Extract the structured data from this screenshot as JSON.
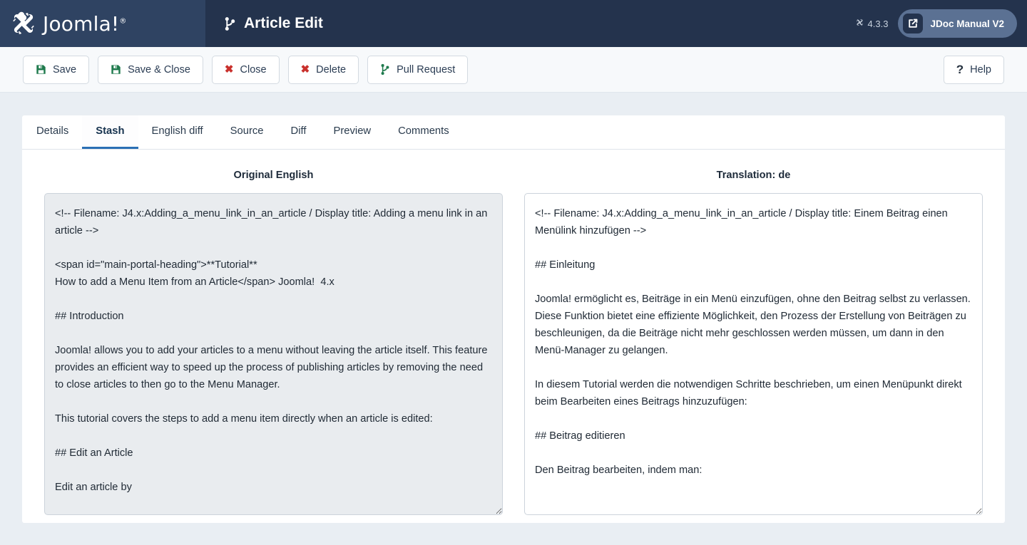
{
  "header": {
    "brand_name": "Joomla!",
    "brand_tm": "®",
    "brand_logo_icon": "joomla-logo-icon",
    "page_title": "Article Edit",
    "page_title_icon": "git-branch-icon",
    "version_label": "4.3.3",
    "version_icon": "joomla-mark-icon",
    "manual_button_label": "JDoc Manual V2",
    "manual_button_icon": "external-link-icon",
    "colors": {
      "brand_bg": "#2f4362",
      "header_bg": "#24334d",
      "manual_btn_bg": "#5b7193"
    }
  },
  "toolbar": {
    "buttons": [
      {
        "label": "Save",
        "icon": "save-floppy-icon",
        "icon_color": "#1f7a4d"
      },
      {
        "label": "Save & Close",
        "icon": "save-floppy-icon",
        "icon_color": "#1f7a4d"
      },
      {
        "label": "Close",
        "icon": "x-mark-icon",
        "icon_color": "#c9302c"
      },
      {
        "label": "Delete",
        "icon": "x-mark-icon",
        "icon_color": "#c9302c"
      },
      {
        "label": "Pull Request",
        "icon": "git-branch-icon",
        "icon_color": "#1f7a4d"
      }
    ],
    "help": {
      "label": "Help",
      "icon": "question-mark-icon"
    }
  },
  "tabs": [
    {
      "label": "Details",
      "active": false
    },
    {
      "label": "Stash",
      "active": true
    },
    {
      "label": "English diff",
      "active": false
    },
    {
      "label": "Source",
      "active": false
    },
    {
      "label": "Diff",
      "active": false
    },
    {
      "label": "Preview",
      "active": false
    },
    {
      "label": "Comments",
      "active": false
    }
  ],
  "panes": {
    "left": {
      "title": "Original English",
      "readonly": true,
      "value": "<!-- Filename: J4.x:Adding_a_menu_link_in_an_article / Display title: Adding a menu link in an article -->\n\n<span id=\"main-portal-heading\">**Tutorial**\nHow to add a Menu Item from an Article</span> Joomla!  4.x\n\n## Introduction\n\nJoomla! allows you to add your articles to a menu without leaving the article itself. This feature provides an efficient way to speed up the process of publishing articles by removing the need to close articles to then go to the Menu Manager.\n\nThis tutorial covers the steps to add a menu item directly when an article is edited:\n\n## Edit an Article\n\nEdit an article by"
    },
    "right": {
      "title": "Translation: de",
      "readonly": false,
      "value": "<!-- Filename: J4.x:Adding_a_menu_link_in_an_article / Display title: Einem Beitrag einen Menülink hinzufügen -->\n\n## Einleitung\n\nJoomla! ermöglicht es, Beiträge in ein Menü einzufügen, ohne den Beitrag selbst zu verlassen. Diese Funktion bietet eine effiziente Möglichkeit, den Prozess der Erstellung von Beiträgen zu beschleunigen, da die Beiträge nicht mehr geschlossen werden müssen, um dann in den Menü-Manager zu gelangen.\n\nIn diesem Tutorial werden die notwendigen Schritte beschrieben, um einen Menüpunkt direkt beim Bearbeiten eines Beitrags hinzuzufügen:\n\n## Beitrag editieren\n\nDen Beitrag bearbeiten, indem man:"
    }
  }
}
